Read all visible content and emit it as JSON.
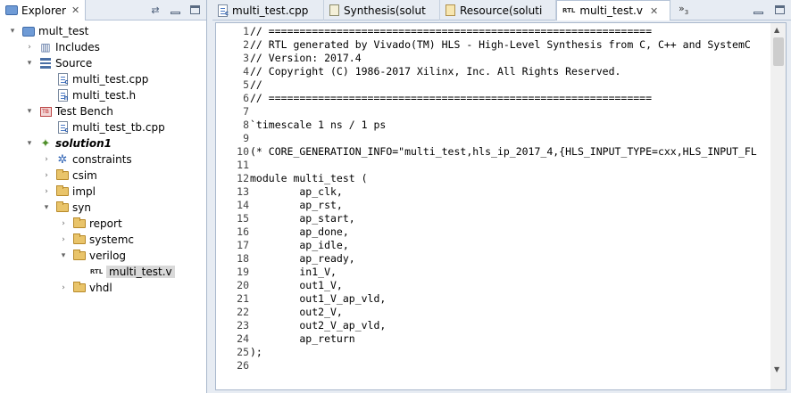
{
  "explorer": {
    "tab_label": "Explorer",
    "close_glyph": "✕",
    "tree": [
      {
        "label": "mult_test",
        "depth": 0,
        "toggle": "▾",
        "icon": "project-icon"
      },
      {
        "label": "Includes",
        "depth": 1,
        "toggle": "›",
        "icon": "includes-icon"
      },
      {
        "label": "Source",
        "depth": 1,
        "toggle": "▾",
        "icon": "source-icon"
      },
      {
        "label": "multi_test.cpp",
        "depth": 2,
        "toggle": "",
        "icon": "cpp-file-icon"
      },
      {
        "label": "multi_test.h",
        "depth": 2,
        "toggle": "",
        "icon": "h-file-icon"
      },
      {
        "label": "Test Bench",
        "depth": 1,
        "toggle": "▾",
        "icon": "testbench-icon"
      },
      {
        "label": "multi_test_tb.cpp",
        "depth": 2,
        "toggle": "",
        "icon": "cpp-file-icon"
      },
      {
        "label": "solution1",
        "depth": 1,
        "toggle": "▾",
        "icon": "solution-icon",
        "bold": true
      },
      {
        "label": "constraints",
        "depth": 2,
        "toggle": "›",
        "icon": "gear-icon"
      },
      {
        "label": "csim",
        "depth": 2,
        "toggle": "›",
        "icon": "folder-icon"
      },
      {
        "label": "impl",
        "depth": 2,
        "toggle": "›",
        "icon": "folder-icon"
      },
      {
        "label": "syn",
        "depth": 2,
        "toggle": "▾",
        "icon": "folder-icon"
      },
      {
        "label": "report",
        "depth": 3,
        "toggle": "›",
        "icon": "folder-icon"
      },
      {
        "label": "systemc",
        "depth": 3,
        "toggle": "›",
        "icon": "folder-icon"
      },
      {
        "label": "verilog",
        "depth": 3,
        "toggle": "▾",
        "icon": "folder-icon"
      },
      {
        "label": "multi_test.v",
        "depth": 4,
        "toggle": "",
        "icon": "rtl-file-icon",
        "selected": true
      },
      {
        "label": "vhdl",
        "depth": 3,
        "toggle": "›",
        "icon": "folder-icon"
      }
    ]
  },
  "editor": {
    "tabs": [
      {
        "label": "multi_test.cpp",
        "icon": "cpp-file-icon",
        "active": false
      },
      {
        "label": "Synthesis(solut",
        "icon": "report-icon",
        "active": false
      },
      {
        "label": "Resource(soluti",
        "icon": "resource-icon",
        "active": false
      },
      {
        "label": "multi_test.v",
        "icon": "rtl-file-icon",
        "active": true
      }
    ],
    "overflow_label": "»",
    "overflow_count": "3",
    "rtl_badge": "RTL",
    "code": [
      {
        "n": "1",
        "text": "// =============================================================="
      },
      {
        "n": "2",
        "text": "// RTL generated by Vivado(TM) HLS - High-Level Synthesis from C, C++ and SystemC"
      },
      {
        "n": "3",
        "text": "// Version: 2017.4"
      },
      {
        "n": "4",
        "text": "// Copyright (C) 1986-2017 Xilinx, Inc. All Rights Reserved."
      },
      {
        "n": "5",
        "text": "//"
      },
      {
        "n": "6",
        "text": "// =============================================================="
      },
      {
        "n": "7",
        "text": ""
      },
      {
        "n": "8",
        "text": "`timescale 1 ns / 1 ps"
      },
      {
        "n": "9",
        "text": ""
      },
      {
        "n": "10",
        "text": "(* CORE_GENERATION_INFO=\"multi_test,hls_ip_2017_4,{HLS_INPUT_TYPE=cxx,HLS_INPUT_FL"
      },
      {
        "n": "11",
        "text": ""
      },
      {
        "n": "12",
        "text": "module multi_test ("
      },
      {
        "n": "13",
        "text": "        ap_clk,"
      },
      {
        "n": "14",
        "text": "        ap_rst,"
      },
      {
        "n": "15",
        "text": "        ap_start,"
      },
      {
        "n": "16",
        "text": "        ap_done,"
      },
      {
        "n": "17",
        "text": "        ap_idle,"
      },
      {
        "n": "18",
        "text": "        ap_ready,"
      },
      {
        "n": "19",
        "text": "        in1_V,"
      },
      {
        "n": "20",
        "text": "        out1_V,"
      },
      {
        "n": "21",
        "text": "        out1_V_ap_vld,"
      },
      {
        "n": "22",
        "text": "        out2_V,"
      },
      {
        "n": "23",
        "text": "        out2_V_ap_vld,"
      },
      {
        "n": "24",
        "text": "        ap_return"
      },
      {
        "n": "25",
        "text": ");"
      },
      {
        "n": "26",
        "text": ""
      }
    ]
  }
}
